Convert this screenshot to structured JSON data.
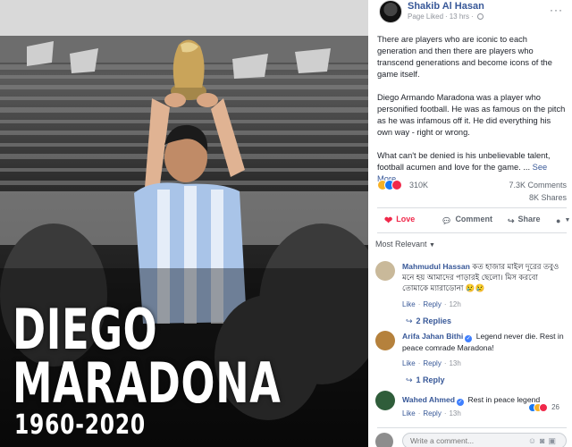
{
  "poster": {
    "first_name": "DIEGO",
    "last_name": "MARADONA",
    "years": "1960-2020"
  },
  "post": {
    "page_name": "Shakib Al Hasan",
    "meta_status": "Page Liked",
    "meta_time": "13 hrs",
    "paragraphs": [
      "There are players who are iconic to each generation and then there are players who transcend generations and become icons of the game itself.",
      "Diego Armando Maradona was a player who personified football. He was as famous on the pitch as he was infamous off it. He did everything his own way - right or wrong.",
      "What can't be denied is his unbelievable talent, football acumen and love for the game. ..."
    ],
    "see_more": "See More",
    "reaction_count": "310K",
    "comment_count": "7.3K Comments",
    "share_count": "8K Shares"
  },
  "actions": {
    "love": "Love",
    "comment": "Comment",
    "share": "Share"
  },
  "comments_sort": "Most Relevant",
  "comments": [
    {
      "name": "Mahmudul Hassan",
      "verified": false,
      "text": "কত হাজার মাইল দূরের তবুও মনে হয় আমাদের পাড়ারই ছেলো। মিস করবো তোমাকে ম্যারাডোনা",
      "like": "Like",
      "reply": "Reply",
      "time": "12h",
      "replies": "2 Replies"
    },
    {
      "name": "Arifa Jahan Bithi",
      "verified": true,
      "text": "Legend never die. Rest in peace comrade Maradona!",
      "like": "Like",
      "reply": "Reply",
      "time": "13h",
      "replies": "1 Reply"
    },
    {
      "name": "Wahed Ahmed",
      "verified": true,
      "text": "Rest in peace legend",
      "like": "Like",
      "reply": "Reply",
      "time": "13h",
      "reaction_count": "26"
    }
  ],
  "composer": {
    "placeholder": "Write a comment..."
  },
  "colors": {
    "link": "#385898",
    "love": "#f0284a",
    "like": "#1877f2",
    "verified": "#4080ff"
  }
}
